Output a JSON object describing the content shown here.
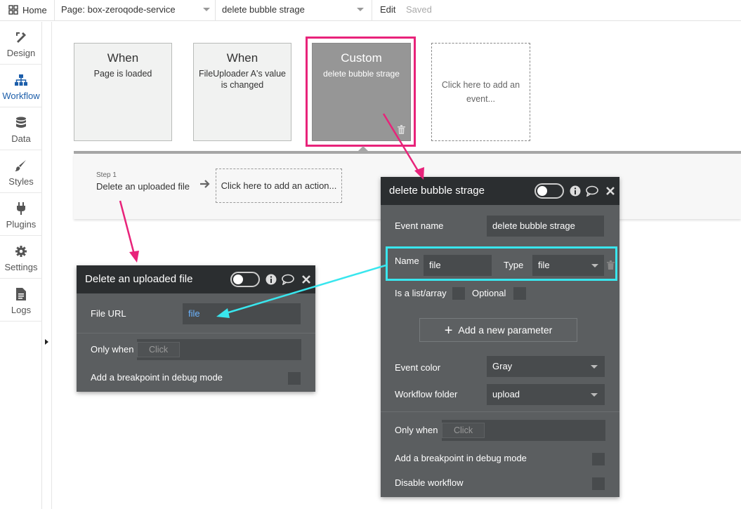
{
  "topbar": {
    "home_label": "Home",
    "page_select": "Page: box-zeroqode-service",
    "event_select": "delete bubble strage",
    "edit_label": "Edit",
    "saved_label": "Saved"
  },
  "sidebar": {
    "items": [
      {
        "label": "Design",
        "icon": "design-icon"
      },
      {
        "label": "Workflow",
        "icon": "workflow-icon",
        "active": true
      },
      {
        "label": "Data",
        "icon": "data-icon"
      },
      {
        "label": "Styles",
        "icon": "brush-icon"
      },
      {
        "label": "Plugins",
        "icon": "plug-icon"
      },
      {
        "label": "Settings",
        "icon": "gear-icon"
      },
      {
        "label": "Logs",
        "icon": "document-icon"
      }
    ]
  },
  "events": [
    {
      "title": "When",
      "subtitle": "Page is loaded"
    },
    {
      "title": "When",
      "subtitle": "FileUploader A's value is changed"
    },
    {
      "title": "Custom",
      "subtitle": "delete bubble strage"
    },
    {
      "add_text": "Click here to add an event..."
    }
  ],
  "workflow": {
    "step_number": "Step 1",
    "step_name": "Delete an uploaded file",
    "add_action": "Click here to add an action..."
  },
  "action_panel": {
    "title": "Delete an uploaded file",
    "file_url_label": "File URL",
    "file_url_value": "file",
    "only_when_label": "Only when",
    "only_when_placeholder": "Click",
    "breakpoint_label": "Add a breakpoint in debug mode"
  },
  "event_panel": {
    "title": "delete bubble strage",
    "event_name_label": "Event name",
    "event_name_value": "delete bubble strage",
    "param_name_label": "Name",
    "param_name_value": "file",
    "param_type_label": "Type",
    "param_type_value": "file",
    "is_list_label": "Is a list/array",
    "optional_label": "Optional",
    "add_param_label": "Add a new parameter",
    "event_color_label": "Event color",
    "event_color_value": "Gray",
    "folder_label": "Workflow folder",
    "folder_value": "upload",
    "only_when_label": "Only when",
    "only_when_placeholder": "Click",
    "breakpoint_label": "Add a breakpoint in debug mode",
    "disable_label": "Disable workflow"
  },
  "colors": {
    "highlight_pink": "#e8237a",
    "highlight_cyan": "#39e6ee",
    "panel_bg": "#5b5e60",
    "panel_header": "#2b2e30",
    "accent_blue": "#1c5eaa"
  }
}
